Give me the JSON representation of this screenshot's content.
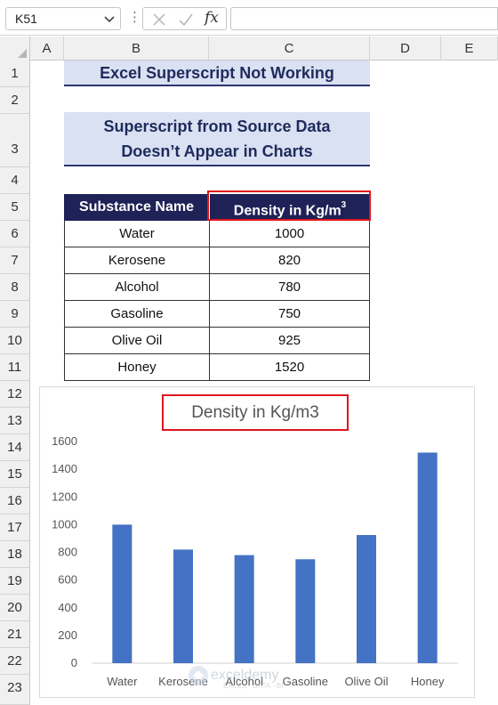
{
  "formula_bar": {
    "name_box": "K51",
    "formula": ""
  },
  "columns": [
    "A",
    "B",
    "C",
    "D",
    "E"
  ],
  "rows": [
    "1",
    "2",
    "3",
    "4",
    "5",
    "6",
    "7",
    "8",
    "9",
    "10",
    "11",
    "12",
    "13",
    "14",
    "15",
    "16",
    "17",
    "18",
    "19",
    "20",
    "21",
    "22",
    "23"
  ],
  "sheet": {
    "title": "Excel Superscript Not Working",
    "subtitle_line1": "Superscript from Source Data",
    "subtitle_line2": "Doesn’t Appear in Charts",
    "header_name": "Substance Name",
    "header_density": "Density in Kg/m",
    "header_density_sup": "3",
    "table": [
      {
        "name": "Water",
        "density": "1000"
      },
      {
        "name": "Kerosene",
        "density": "820"
      },
      {
        "name": "Alcohol",
        "density": "780"
      },
      {
        "name": "Gasoline",
        "density": "750"
      },
      {
        "name": "Olive Oil",
        "density": "925"
      },
      {
        "name": "Honey",
        "density": "1520"
      }
    ]
  },
  "chart_data": {
    "type": "bar",
    "title": "Density in Kg/m3",
    "categories": [
      "Water",
      "Kerosene",
      "Alcohol",
      "Gasoline",
      "Olive Oil",
      "Honey"
    ],
    "values": [
      1000,
      820,
      780,
      750,
      925,
      1520
    ],
    "ylim": [
      0,
      1600
    ],
    "yticks": [
      0,
      200,
      400,
      600,
      800,
      1000,
      1200,
      1400,
      1600
    ],
    "xlabel": "",
    "ylabel": "",
    "grid": false,
    "bar_color": "#4472c4"
  },
  "colors": {
    "title_fill": "#d9e1f2",
    "header_fill": "#1f2256",
    "highlight": "#e0141e"
  },
  "watermark": {
    "text": "exceldemy",
    "tagline": "EXCEL · DATA · BI"
  }
}
